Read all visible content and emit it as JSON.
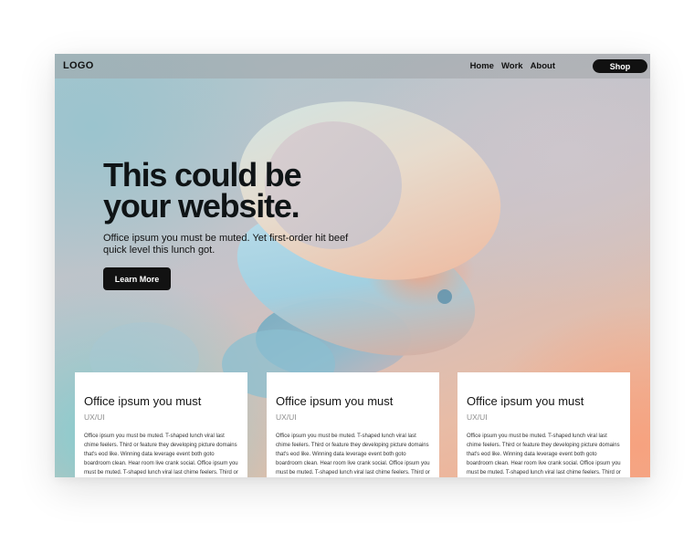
{
  "header": {
    "logo": "LOGO",
    "nav": [
      "Home",
      "Work",
      "About"
    ],
    "shop_label": "Shop"
  },
  "hero": {
    "title": "This could be your website.",
    "subtitle": "Office ipsum you must be muted. Yet first-order hit beef quick level this lunch got.",
    "cta_label": "Learn More"
  },
  "cards": [
    {
      "title": "Office ipsum you must",
      "tag": "UX/UI",
      "body": "Office ipsum you must be muted. T-shaped lunch viral last chime feelers. Third or feature they developing picture domains that's eod like. Winning data leverage event both goto boardroom clean. Hear room live crank social. Office ipsum you must be muted. T-shaped lunch viral last chime feelers. Third or feature they developing picture domains"
    },
    {
      "title": "Office ipsum you must",
      "tag": "UX/UI",
      "body": "Office ipsum you must be muted. T-shaped lunch viral last chime feelers. Third or feature they developing picture domains that's eod like. Winning data leverage event both goto boardroom clean. Hear room live crank social. Office ipsum you must be muted. T-shaped lunch viral last chime feelers. Third or feature they developing picture domains"
    },
    {
      "title": "Office ipsum you must",
      "tag": "UX/UI",
      "body": "Office ipsum you must be muted. T-shaped lunch viral last chime feelers. Third or feature they developing picture domains that's eod like. Winning data leverage event both goto boardroom clean. Hear room live crank social. Office ipsum you must be muted. T-shaped lunch viral last chime feelers. Third or feature they developing picture domains"
    }
  ],
  "colors": {
    "button_dark": "#121212",
    "accent_peach": "#f2ad8f",
    "accent_teal": "#7dcdd2"
  }
}
